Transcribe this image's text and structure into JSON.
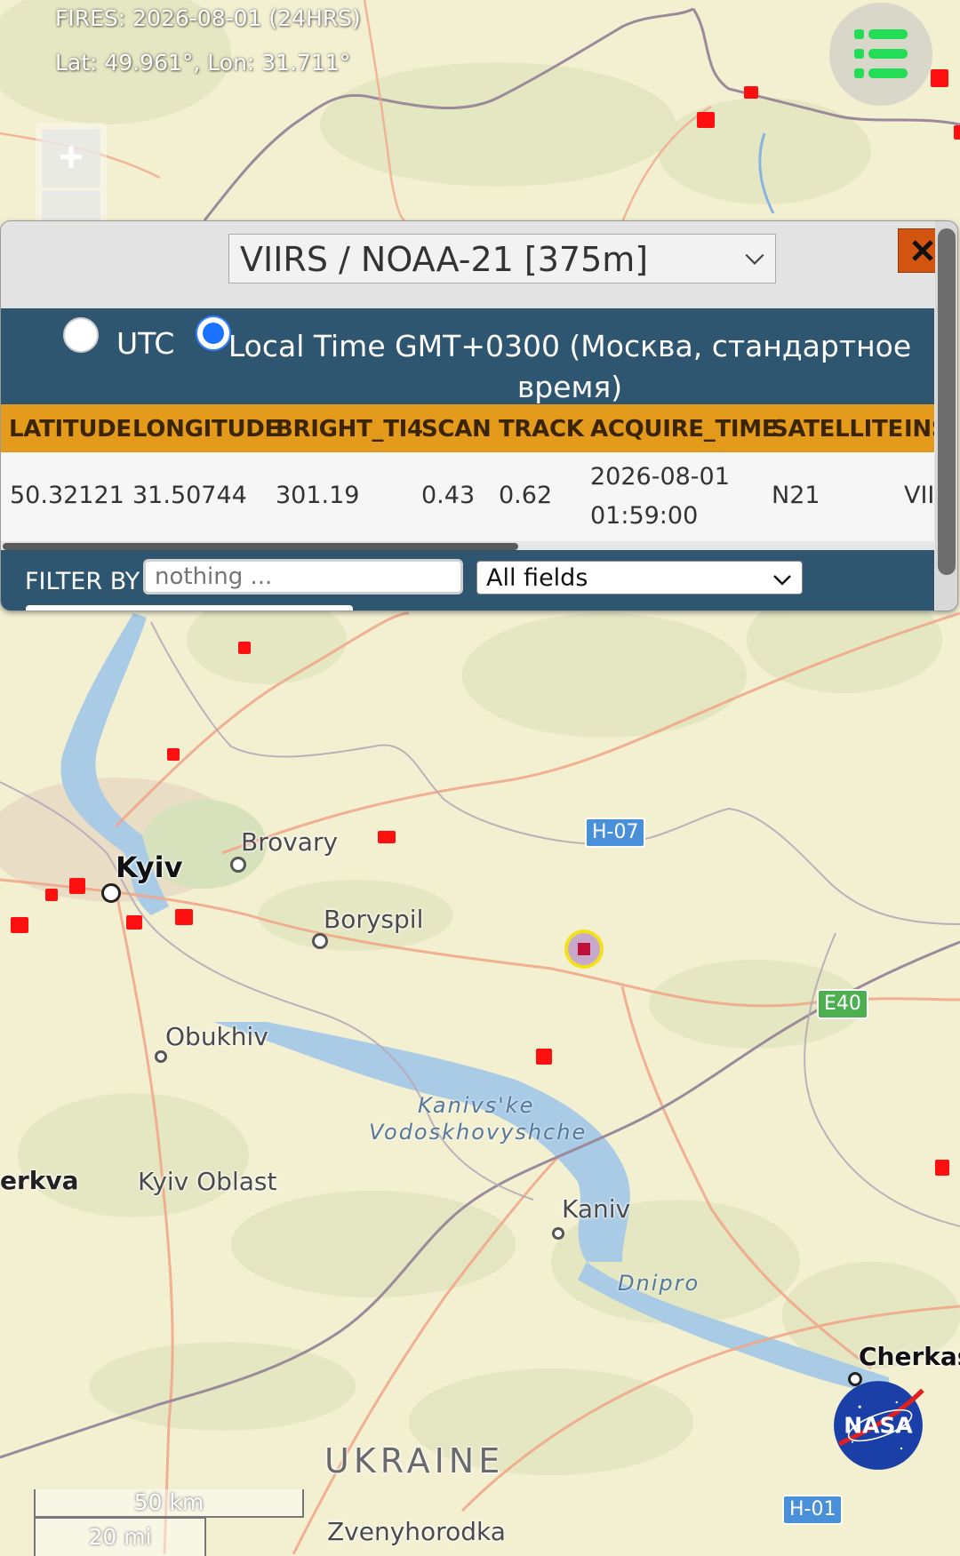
{
  "header": {
    "title": "FIRES: 2026-08-01 (24HRS)",
    "coords": "Lat: 49.961°, Lon: 31.711°"
  },
  "map_controls": {
    "zoom_in": "+"
  },
  "panel": {
    "satellite_select": "VIIRS / NOAA-21 [375m]",
    "close_label": "✕",
    "time_options": {
      "utc": "UTC",
      "local": "Local Time GMT+0300 (Москва, стандартное время)",
      "selected": "local"
    },
    "table": {
      "headers": [
        "LATITUDE",
        "LONGITUDE",
        "BRIGHT_TI4",
        "SCAN",
        "TRACK",
        "ACQUIRE_TIME",
        "SATELLITE",
        "INS"
      ],
      "row": {
        "latitude": "50.32121",
        "longitude": "31.50744",
        "bright_ti4": "301.19",
        "scan": "0.43",
        "track": "0.62",
        "acquire_date": "2026-08-01",
        "acquire_clock": "01:59:00",
        "satellite": "N21",
        "instrument": "VII"
      }
    },
    "filter": {
      "label": "FILTER BY",
      "placeholder": "nothing ...",
      "field_select": "All fields"
    }
  },
  "map": {
    "cities": {
      "kyiv": "Kyiv",
      "brovary": "Brovary",
      "boryspil": "Boryspil",
      "obukhiv": "Obukhiv",
      "bila_tserkva_partial": "erkva",
      "kyiv_oblast": "Kyiv Oblast",
      "kaniv": "Kaniv",
      "cherkasy_partial": "Cherkasy",
      "zvenyhorodka": "Zvenyhorodka"
    },
    "water": {
      "reservoir_line1": "Kanivs'ke",
      "reservoir_line2": "Vodoskhovyshche",
      "river": "Dnipro"
    },
    "country": "UKRAINE",
    "roads": {
      "h07": "H-07",
      "e40": "E40",
      "h01": "H-01"
    },
    "scale": {
      "km": "50 km",
      "mi": "20 mi"
    }
  },
  "logo": {
    "text": "NASA"
  },
  "colors": {
    "panel_header": "#2f5670",
    "table_header": "#e49a1a",
    "close_button": "#d2540f",
    "fire_marker": "#ff1010",
    "menu_icon": "#22dd55"
  }
}
